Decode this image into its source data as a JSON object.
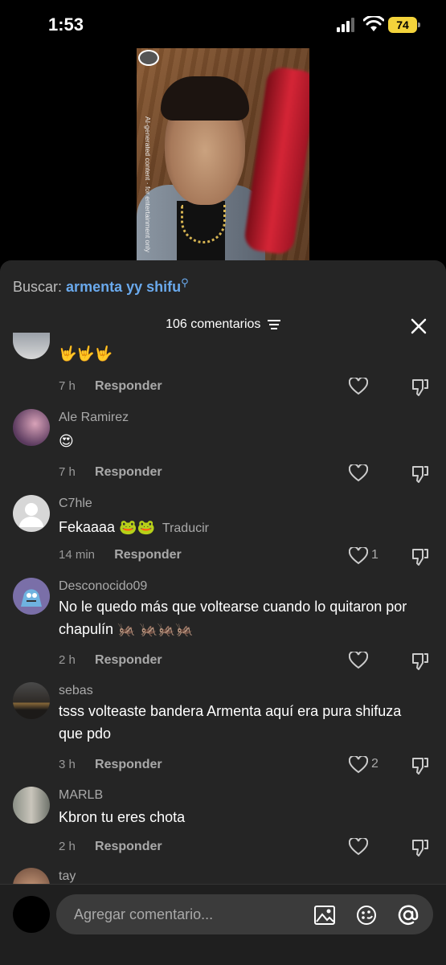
{
  "status_bar": {
    "time": "1:53",
    "battery": "74"
  },
  "video": {
    "ai_label": "AI-generated content · for entertainment only"
  },
  "search": {
    "prefix": "Buscar:",
    "query": "armenta yy shifu"
  },
  "comments_header": {
    "count_label": "106 comentarios"
  },
  "comments": [
    {
      "name": "",
      "text": "🤟🤟🤟",
      "time": "7 h",
      "reply": "Responder",
      "likes": "",
      "translate": ""
    },
    {
      "name": "Ale Ramirez",
      "text": "😍",
      "time": "7 h",
      "reply": "Responder",
      "likes": "",
      "translate": ""
    },
    {
      "name": "C7hle",
      "text": "Fekaaaa 🐸🐸",
      "time": "14 min",
      "reply": "Responder",
      "likes": "1",
      "translate": "Traducir"
    },
    {
      "name": "Desconocido09",
      "text": "No le quedo más que voltearse cuando lo quitaron por chapulín 🦗 🦗🦗🦗",
      "time": "2 h",
      "reply": "Responder",
      "likes": "",
      "translate": ""
    },
    {
      "name": "sebas",
      "text": "tsss volteaste bandera Armenta aquí era pura shifuza que pdo",
      "time": "3 h",
      "reply": "Responder",
      "likes": "2",
      "translate": ""
    },
    {
      "name": "MARLB",
      "text": "Kbron tu eres chota",
      "time": "2 h",
      "reply": "Responder",
      "likes": "",
      "translate": ""
    },
    {
      "name": "tay",
      "text": "",
      "time": "",
      "reply": "",
      "likes": "",
      "translate": ""
    }
  ],
  "input": {
    "placeholder": "Agregar comentario..."
  },
  "icons": [
    "signal-icon",
    "wifi-icon",
    "sort-icon",
    "close-icon",
    "heart-icon",
    "dislike-icon",
    "image-icon",
    "emoji-icon",
    "mention-icon"
  ],
  "colors": {
    "accent_link": "#6aa9ec",
    "sheet_bg": "#252525",
    "battery": "#f3d33b"
  }
}
